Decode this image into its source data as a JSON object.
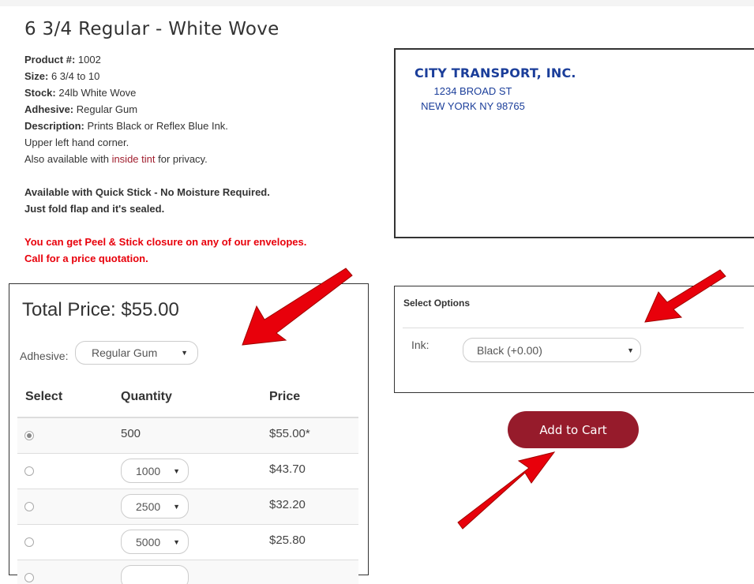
{
  "product": {
    "title": "6 3/4 Regular - White Wove",
    "details": [
      {
        "label": "Product #:",
        "value": " 1002"
      },
      {
        "label": "Size:",
        "value": " 6 3/4 to 10"
      },
      {
        "label": "Stock:",
        "value": " 24lb White Wove"
      },
      {
        "label": "Adhesive:",
        "value": " Regular Gum"
      },
      {
        "label": "Description:",
        "value": " Prints Black or Reflex Blue Ink."
      }
    ],
    "line_corner": "Upper left hand corner.",
    "line_tint_pre": "Also available with ",
    "line_tint_link": "inside tint",
    "line_tint_post": " for privacy.",
    "quick_stick_1": "Available with Quick Stick - No Moisture Required.",
    "quick_stick_2": "Just fold flap and it's sealed.",
    "peel_1": "You can get Peel & Stick closure on any of our envelopes.",
    "peel_2": "Call for a price quotation."
  },
  "preview": {
    "company": "CITY TRANSPORT, INC.",
    "address_1": "1234 BROAD ST",
    "address_2": "NEW YORK NY 98765",
    "text_color": "#1b3e9a"
  },
  "pricing": {
    "total_label": "Total Price: $55.00",
    "adhesive_label": "Adhesive:",
    "adhesive_value": "Regular Gum",
    "headers": {
      "select": "Select",
      "quantity": "Quantity",
      "price": "Price"
    },
    "rows": [
      {
        "quantity": "500",
        "price": "$55.00*",
        "selected": true
      },
      {
        "quantity": "1000",
        "price": "$43.70",
        "selected": false
      },
      {
        "quantity": "2500",
        "price": "$32.20",
        "selected": false
      },
      {
        "quantity": "5000",
        "price": "$25.80",
        "selected": false
      }
    ]
  },
  "options": {
    "title": "Select Options",
    "ink_label": "Ink:",
    "ink_value": "Black (+0.00)"
  },
  "cart": {
    "label": "Add to Cart",
    "color": "#961b2b"
  },
  "icons": {
    "caret": "▼",
    "annotation_arrow_color": "#e8000b"
  }
}
